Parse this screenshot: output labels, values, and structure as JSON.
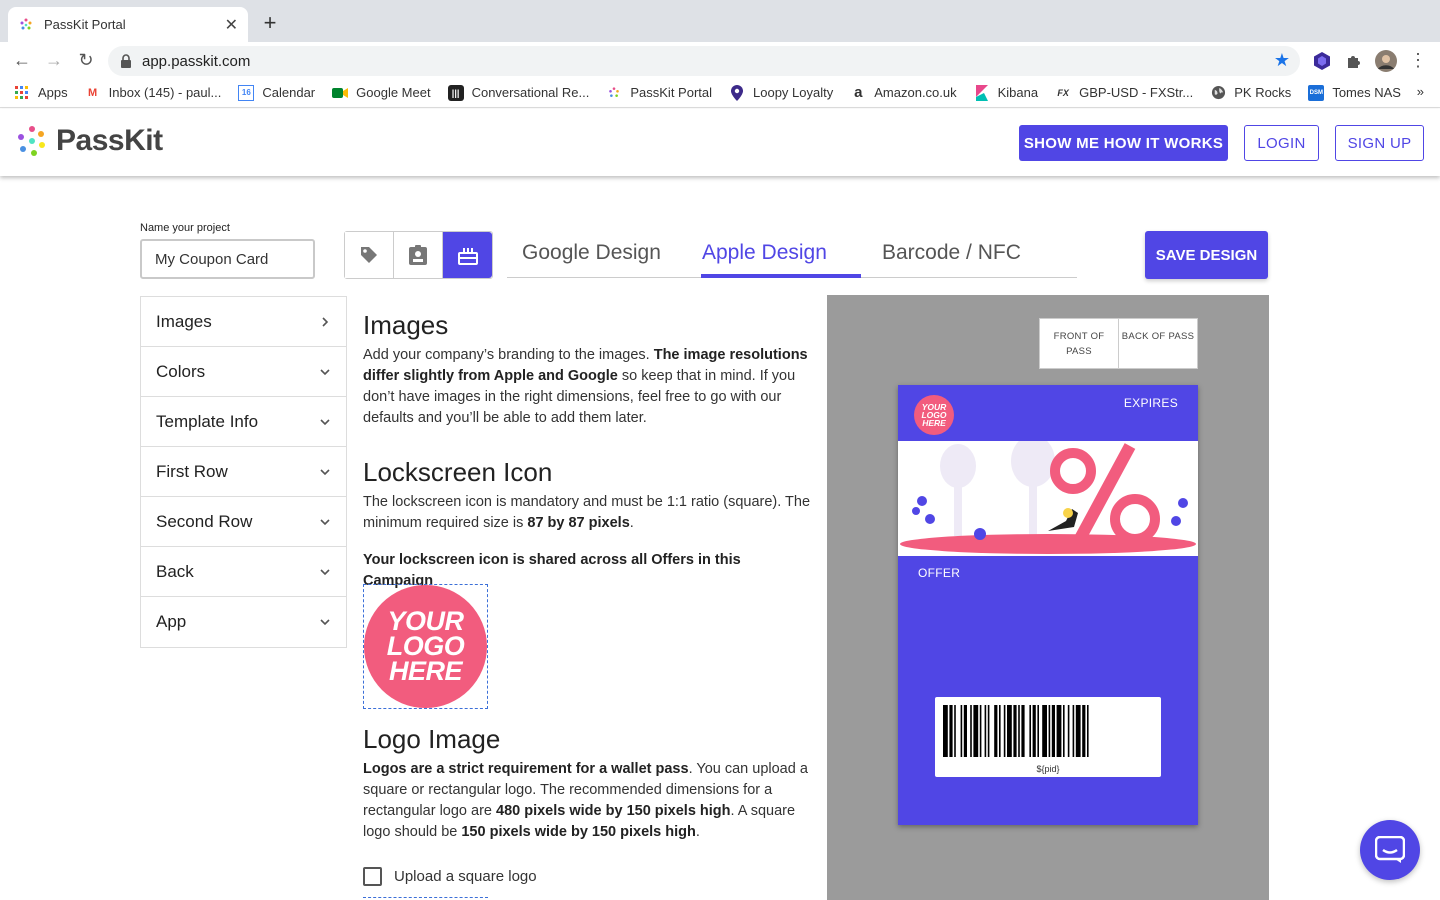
{
  "browser": {
    "tab_title": "PassKit Portal",
    "url": "app.passkit.com",
    "bookmarks": [
      {
        "label": "Apps",
        "icon": "apps-grid-icon"
      },
      {
        "label": "Inbox (145) - paul...",
        "icon": "gmail-icon"
      },
      {
        "label": "Calendar",
        "icon": "calendar-icon"
      },
      {
        "label": "Google Meet",
        "icon": "meet-icon"
      },
      {
        "label": "Conversational Re...",
        "icon": "intercom-icon"
      },
      {
        "label": "PassKit Portal",
        "icon": "passkit-icon"
      },
      {
        "label": "Loopy Loyalty",
        "icon": "location-pin-icon"
      },
      {
        "label": "Amazon.co.uk",
        "icon": "amazon-icon"
      },
      {
        "label": "Kibana",
        "icon": "kibana-icon"
      },
      {
        "label": "GBP-USD - FXStr...",
        "icon": "fx-icon"
      },
      {
        "label": "PK Rocks",
        "icon": "globe-icon"
      },
      {
        "label": "Tomes NAS",
        "icon": "dsm-icon"
      }
    ],
    "bookmarks_more": "»"
  },
  "header": {
    "brand": "PassKit",
    "show_me_label": "SHOW ME HOW IT WORKS",
    "login_label": "LOGIN",
    "signup_label": "SIGN UP"
  },
  "editor": {
    "project_label": "Name your project",
    "project_value": "My Coupon Card",
    "tabs": [
      "Google Design",
      "Apple Design",
      "Barcode / NFC"
    ],
    "active_tab": "Apple Design",
    "save_label": "SAVE DESIGN",
    "accordion": [
      "Images",
      "Colors",
      "Template Info",
      "First Row",
      "Second Row",
      "Back",
      "App"
    ]
  },
  "content": {
    "images_heading": "Images",
    "images_p1": "Add your company’s branding to the images. ",
    "images_p1_bold": "The image resolutions differ slightly from Apple and Google",
    "images_p1_rest": " so keep that in mind. If you don’t have images in the right dimensions, feel free to go with our defaults and you’ll be able to add them later.",
    "lock_heading": "Lockscreen Icon",
    "lock_p1": "The lockscreen icon is mandatory and must be 1:1 ratio (square). The minimum required size is ",
    "lock_p1_bold": "87 by 87 pixels",
    "lock_p1_end": ".",
    "lock_shared": "Your lockscreen icon is shared across all Offers in this Campaign",
    "logo_placeholder": [
      "YOUR",
      "LOGO",
      "HERE"
    ],
    "logo_heading": "Logo Image",
    "logo_p_bold1": "Logos are a strict requirement for a wallet pass",
    "logo_p_mid": ". You can upload a square or rectangular logo. The recommended dimensions for a rectangular logo are ",
    "logo_p_bold2": "480 pixels wide by 150 pixels high",
    "logo_p_mid2": ". A square logo should be ",
    "logo_p_bold3": "150 pixels wide by 150 pixels high",
    "logo_p_end": ".",
    "upload_square_label": "Upload a square logo"
  },
  "preview": {
    "front_label": "FRONT OF PASS",
    "back_label": "BACK OF PASS",
    "expires_label": "EXPIRES",
    "offer_label": "OFFER",
    "barcode_text": "${pid}",
    "logo_lines": [
      "YOUR",
      "LOGO",
      "HERE"
    ]
  },
  "colors": {
    "accent": "#5046e5",
    "logo_pink": "#f25c7e",
    "preview_bg": "#9b9b9b"
  }
}
